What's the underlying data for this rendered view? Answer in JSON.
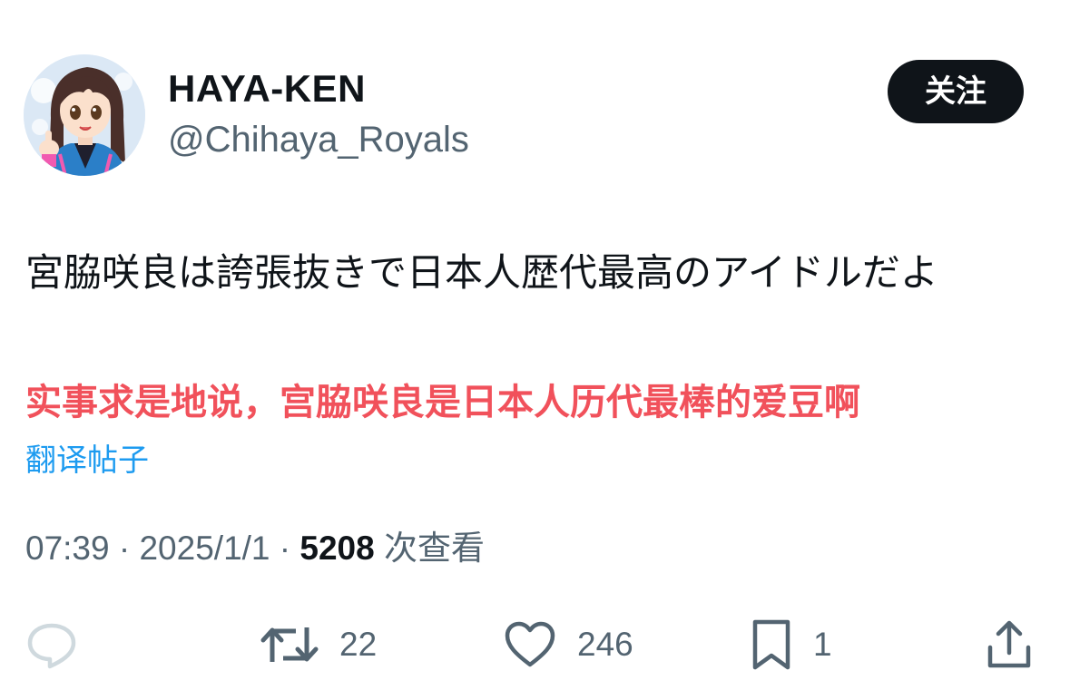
{
  "author": {
    "display_name": "HAYA-KEN",
    "handle": "@Chihaya_Royals",
    "avatar_icon": "anime-girl-avatar"
  },
  "follow_button": {
    "label": "关注"
  },
  "post": {
    "text": "宮脇咲良は誇張抜きで日本人歴代最高のアイドルだよ",
    "caption": "实事求是地说，宫脇咲良是日本人历代最棒的爱豆啊",
    "translate_label": "翻译帖子"
  },
  "meta": {
    "time": "07:39",
    "separator": "·",
    "date": "2025/1/1",
    "views_count": "5208",
    "views_label": "次查看"
  },
  "actions": {
    "reply": {
      "icon": "reply-icon",
      "count": ""
    },
    "repost": {
      "icon": "repost-icon",
      "count": "22"
    },
    "like": {
      "icon": "heart-icon",
      "count": "246"
    },
    "bookmark": {
      "icon": "bookmark-icon",
      "count": "1"
    },
    "share": {
      "icon": "share-icon",
      "count": ""
    }
  },
  "colors": {
    "text_primary": "#0f1419",
    "text_secondary": "#536471",
    "link": "#1d9bf0",
    "caption_red": "#f1515b",
    "button_bg": "#0f1419",
    "reply_icon_faded": "#cfd9de"
  }
}
